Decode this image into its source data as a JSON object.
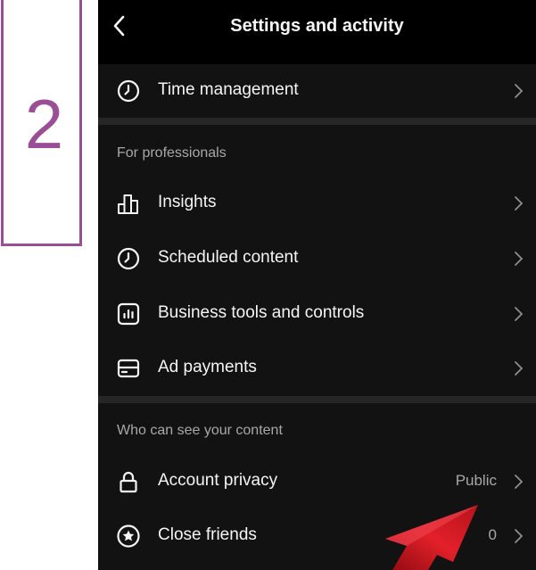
{
  "annotation": {
    "step_number": "2",
    "color": "#9b4d96"
  },
  "header": {
    "title": "Settings and activity",
    "back_icon": "chevron-left-icon"
  },
  "rows": {
    "time_management": {
      "label": "Time management",
      "icon": "clock-icon"
    },
    "insights": {
      "label": "Insights",
      "icon": "bar-chart-icon"
    },
    "scheduled_content": {
      "label": "Scheduled content",
      "icon": "clock-icon"
    },
    "business_tools": {
      "label": "Business tools and controls",
      "icon": "business-tools-icon"
    },
    "ad_payments": {
      "label": "Ad payments",
      "icon": "credit-card-icon"
    },
    "account_privacy": {
      "label": "Account privacy",
      "value": "Public",
      "icon": "lock-icon"
    },
    "close_friends": {
      "label": "Close friends",
      "value": "0",
      "icon": "star-circle-icon"
    }
  },
  "sections": {
    "professionals": {
      "heading": "For professionals"
    },
    "visibility": {
      "heading": "Who can see your content"
    }
  },
  "colors": {
    "background": "#000000",
    "section_bg": "#121212",
    "text": "#f5f5f5",
    "muted": "#a8a8a8",
    "arrow": "#d0141e"
  }
}
